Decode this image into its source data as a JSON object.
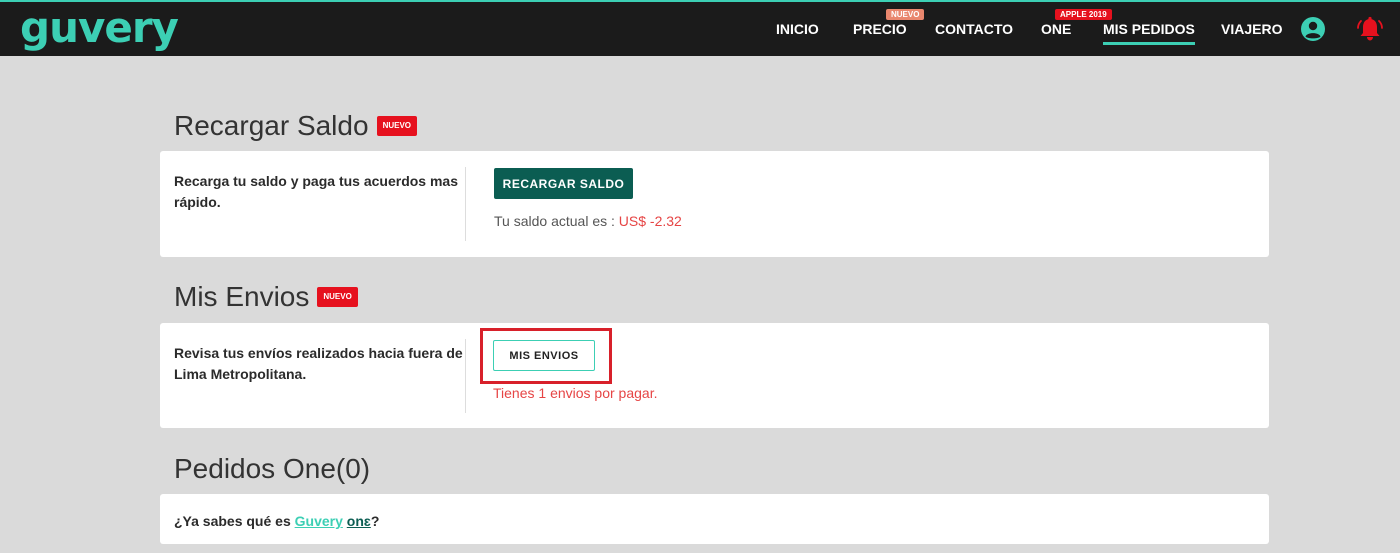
{
  "header": {
    "logo": "guvery",
    "nav": [
      {
        "label": "INICIO"
      },
      {
        "label": "PRECIO",
        "badge": "NUEVO"
      },
      {
        "label": "CONTACTO"
      },
      {
        "label": "ONE",
        "badge": "APPLE 2019"
      },
      {
        "label": "MIS PEDIDOS",
        "active": true
      },
      {
        "label": "VIAJERO"
      }
    ],
    "icons": [
      "user-icon",
      "bell-icon"
    ]
  },
  "recargar": {
    "title": "Recargar Saldo",
    "badge": "NUEVO",
    "description": "Recarga tu saldo y paga tus acuerdos mas rápido.",
    "button": "RECARGAR SALDO",
    "saldo_label": "Tu saldo actual es : ",
    "saldo_value": "US$ -2.32"
  },
  "envios": {
    "title": "Mis Envios",
    "badge": "NUEVO",
    "description": "Revisa tus envíos realizados hacia fuera de Lima Metropolitana.",
    "button": "MIS ENVIOS",
    "status": "Tienes 1 envios por pagar."
  },
  "pedidos_one": {
    "title": "Pedidos One(0)",
    "question_prefix": "¿Ya sabes qué es ",
    "link_text": "Guvery",
    "one_word": "onɛ",
    "question_suffix": "?"
  },
  "colors": {
    "accent": "#3ccfb4",
    "primary_button": "#0b5d52",
    "badge_red": "#e6111e",
    "error_text": "#e64545",
    "header_bg": "#1b1b1b"
  }
}
